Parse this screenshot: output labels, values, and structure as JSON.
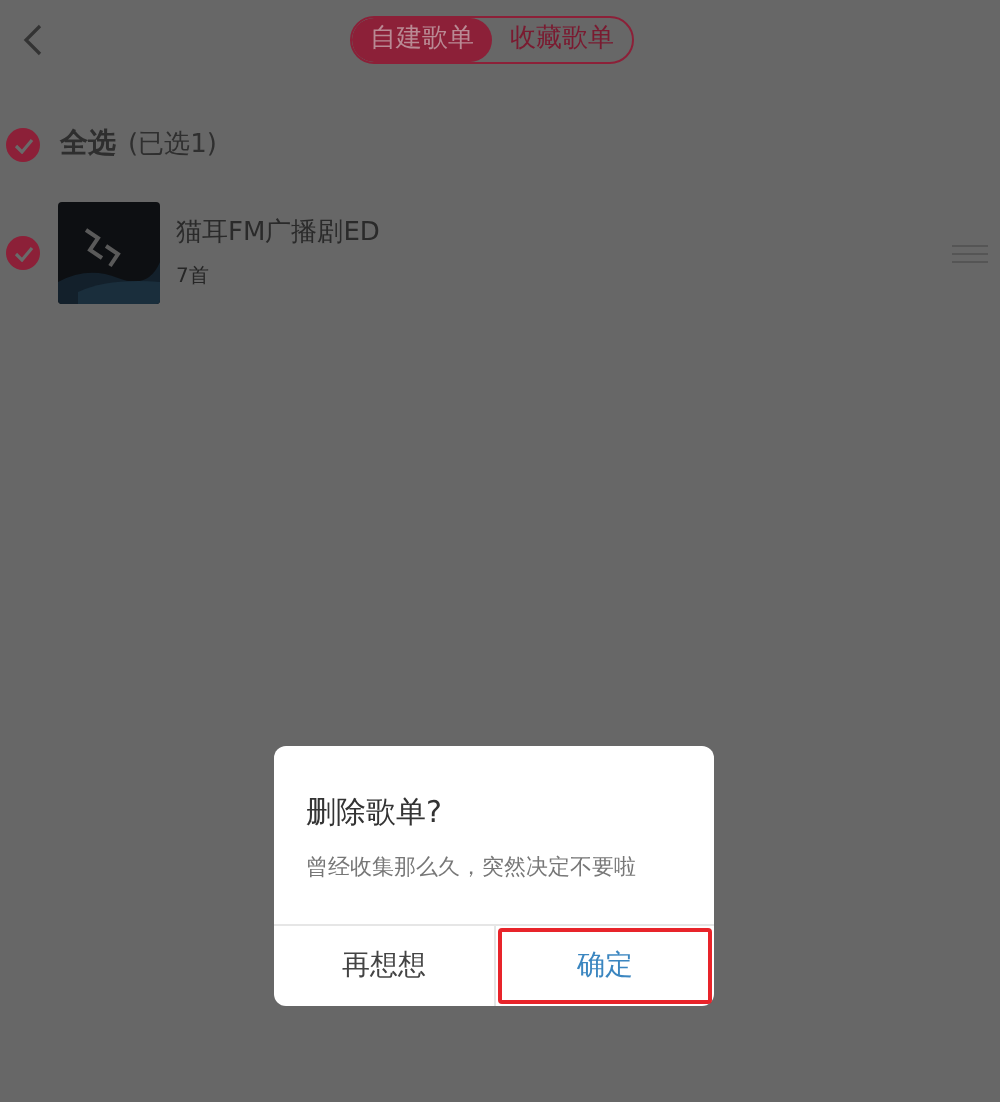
{
  "header": {
    "tabs": [
      {
        "label": "自建歌单",
        "selected": true
      },
      {
        "label": "收藏歌单",
        "selected": false
      }
    ]
  },
  "select_all": {
    "label": "全选",
    "count": "(已选1)",
    "checked": true
  },
  "playlists": [
    {
      "title": "猫耳FM广播剧ED",
      "subtitle": "7首",
      "checked": true
    }
  ],
  "dialog": {
    "title": "删除歌单?",
    "message": "曾经收集那么久，突然决定不要啦",
    "buttons": [
      {
        "label": "再想想",
        "kind": "cancel",
        "highlighted": false
      },
      {
        "label": "确定",
        "kind": "confirm",
        "highlighted": true
      }
    ]
  }
}
